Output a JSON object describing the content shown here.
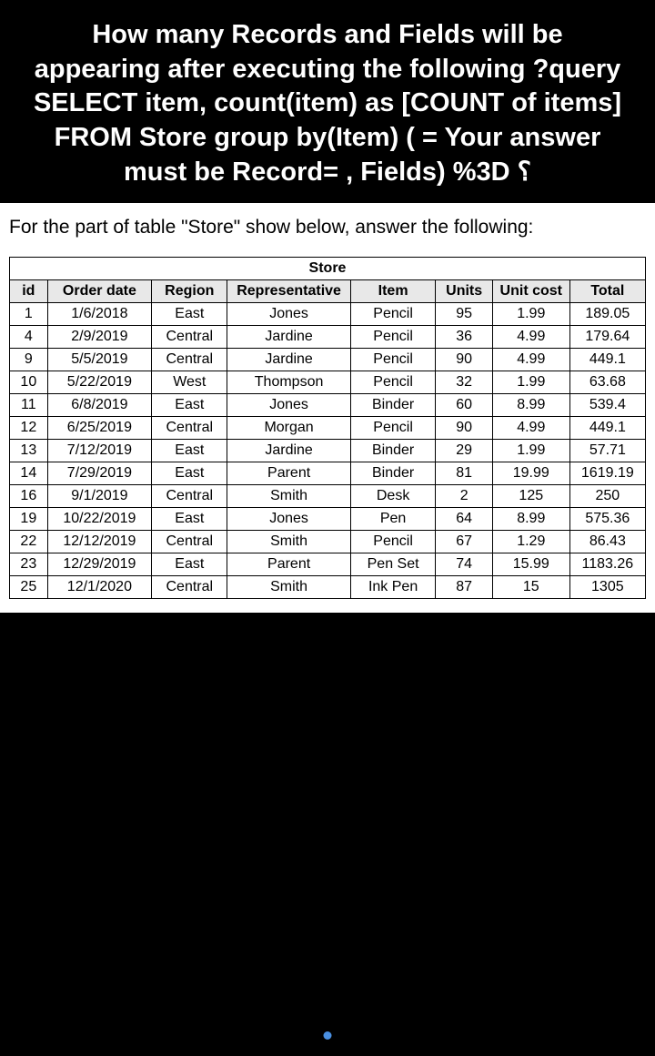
{
  "question": "How many Records and Fields will be appearing after executing the following ?query SELECT item, count(item) as [COUNT of items] FROM Store group by(Item) ( = Your answer must be Record= , Fields) %3D ؟",
  "instruction": "For the part of table \"Store\" show below, answer the following:",
  "table": {
    "title": "Store",
    "headers": [
      "id",
      "Order date",
      "Region",
      "Representative",
      "Item",
      "Units",
      "Unit cost",
      "Total"
    ],
    "rows": [
      [
        "1",
        "1/6/2018",
        "East",
        "Jones",
        "Pencil",
        "95",
        "1.99",
        "189.05"
      ],
      [
        "4",
        "2/9/2019",
        "Central",
        "Jardine",
        "Pencil",
        "36",
        "4.99",
        "179.64"
      ],
      [
        "9",
        "5/5/2019",
        "Central",
        "Jardine",
        "Pencil",
        "90",
        "4.99",
        "449.1"
      ],
      [
        "10",
        "5/22/2019",
        "West",
        "Thompson",
        "Pencil",
        "32",
        "1.99",
        "63.68"
      ],
      [
        "11",
        "6/8/2019",
        "East",
        "Jones",
        "Binder",
        "60",
        "8.99",
        "539.4"
      ],
      [
        "12",
        "6/25/2019",
        "Central",
        "Morgan",
        "Pencil",
        "90",
        "4.99",
        "449.1"
      ],
      [
        "13",
        "7/12/2019",
        "East",
        "Jardine",
        "Binder",
        "29",
        "1.99",
        "57.71"
      ],
      [
        "14",
        "7/29/2019",
        "East",
        "Parent",
        "Binder",
        "81",
        "19.99",
        "1619.19"
      ],
      [
        "16",
        "9/1/2019",
        "Central",
        "Smith",
        "Desk",
        "2",
        "125",
        "250"
      ],
      [
        "19",
        "10/22/2019",
        "East",
        "Jones",
        "Pen",
        "64",
        "8.99",
        "575.36"
      ],
      [
        "22",
        "12/12/2019",
        "Central",
        "Smith",
        "Pencil",
        "67",
        "1.29",
        "86.43"
      ],
      [
        "23",
        "12/29/2019",
        "East",
        "Parent",
        "Pen Set",
        "74",
        "15.99",
        "1183.26"
      ],
      [
        "25",
        "12/1/2020",
        "Central",
        "Smith",
        "Ink Pen",
        "87",
        "15",
        "1305"
      ]
    ]
  }
}
